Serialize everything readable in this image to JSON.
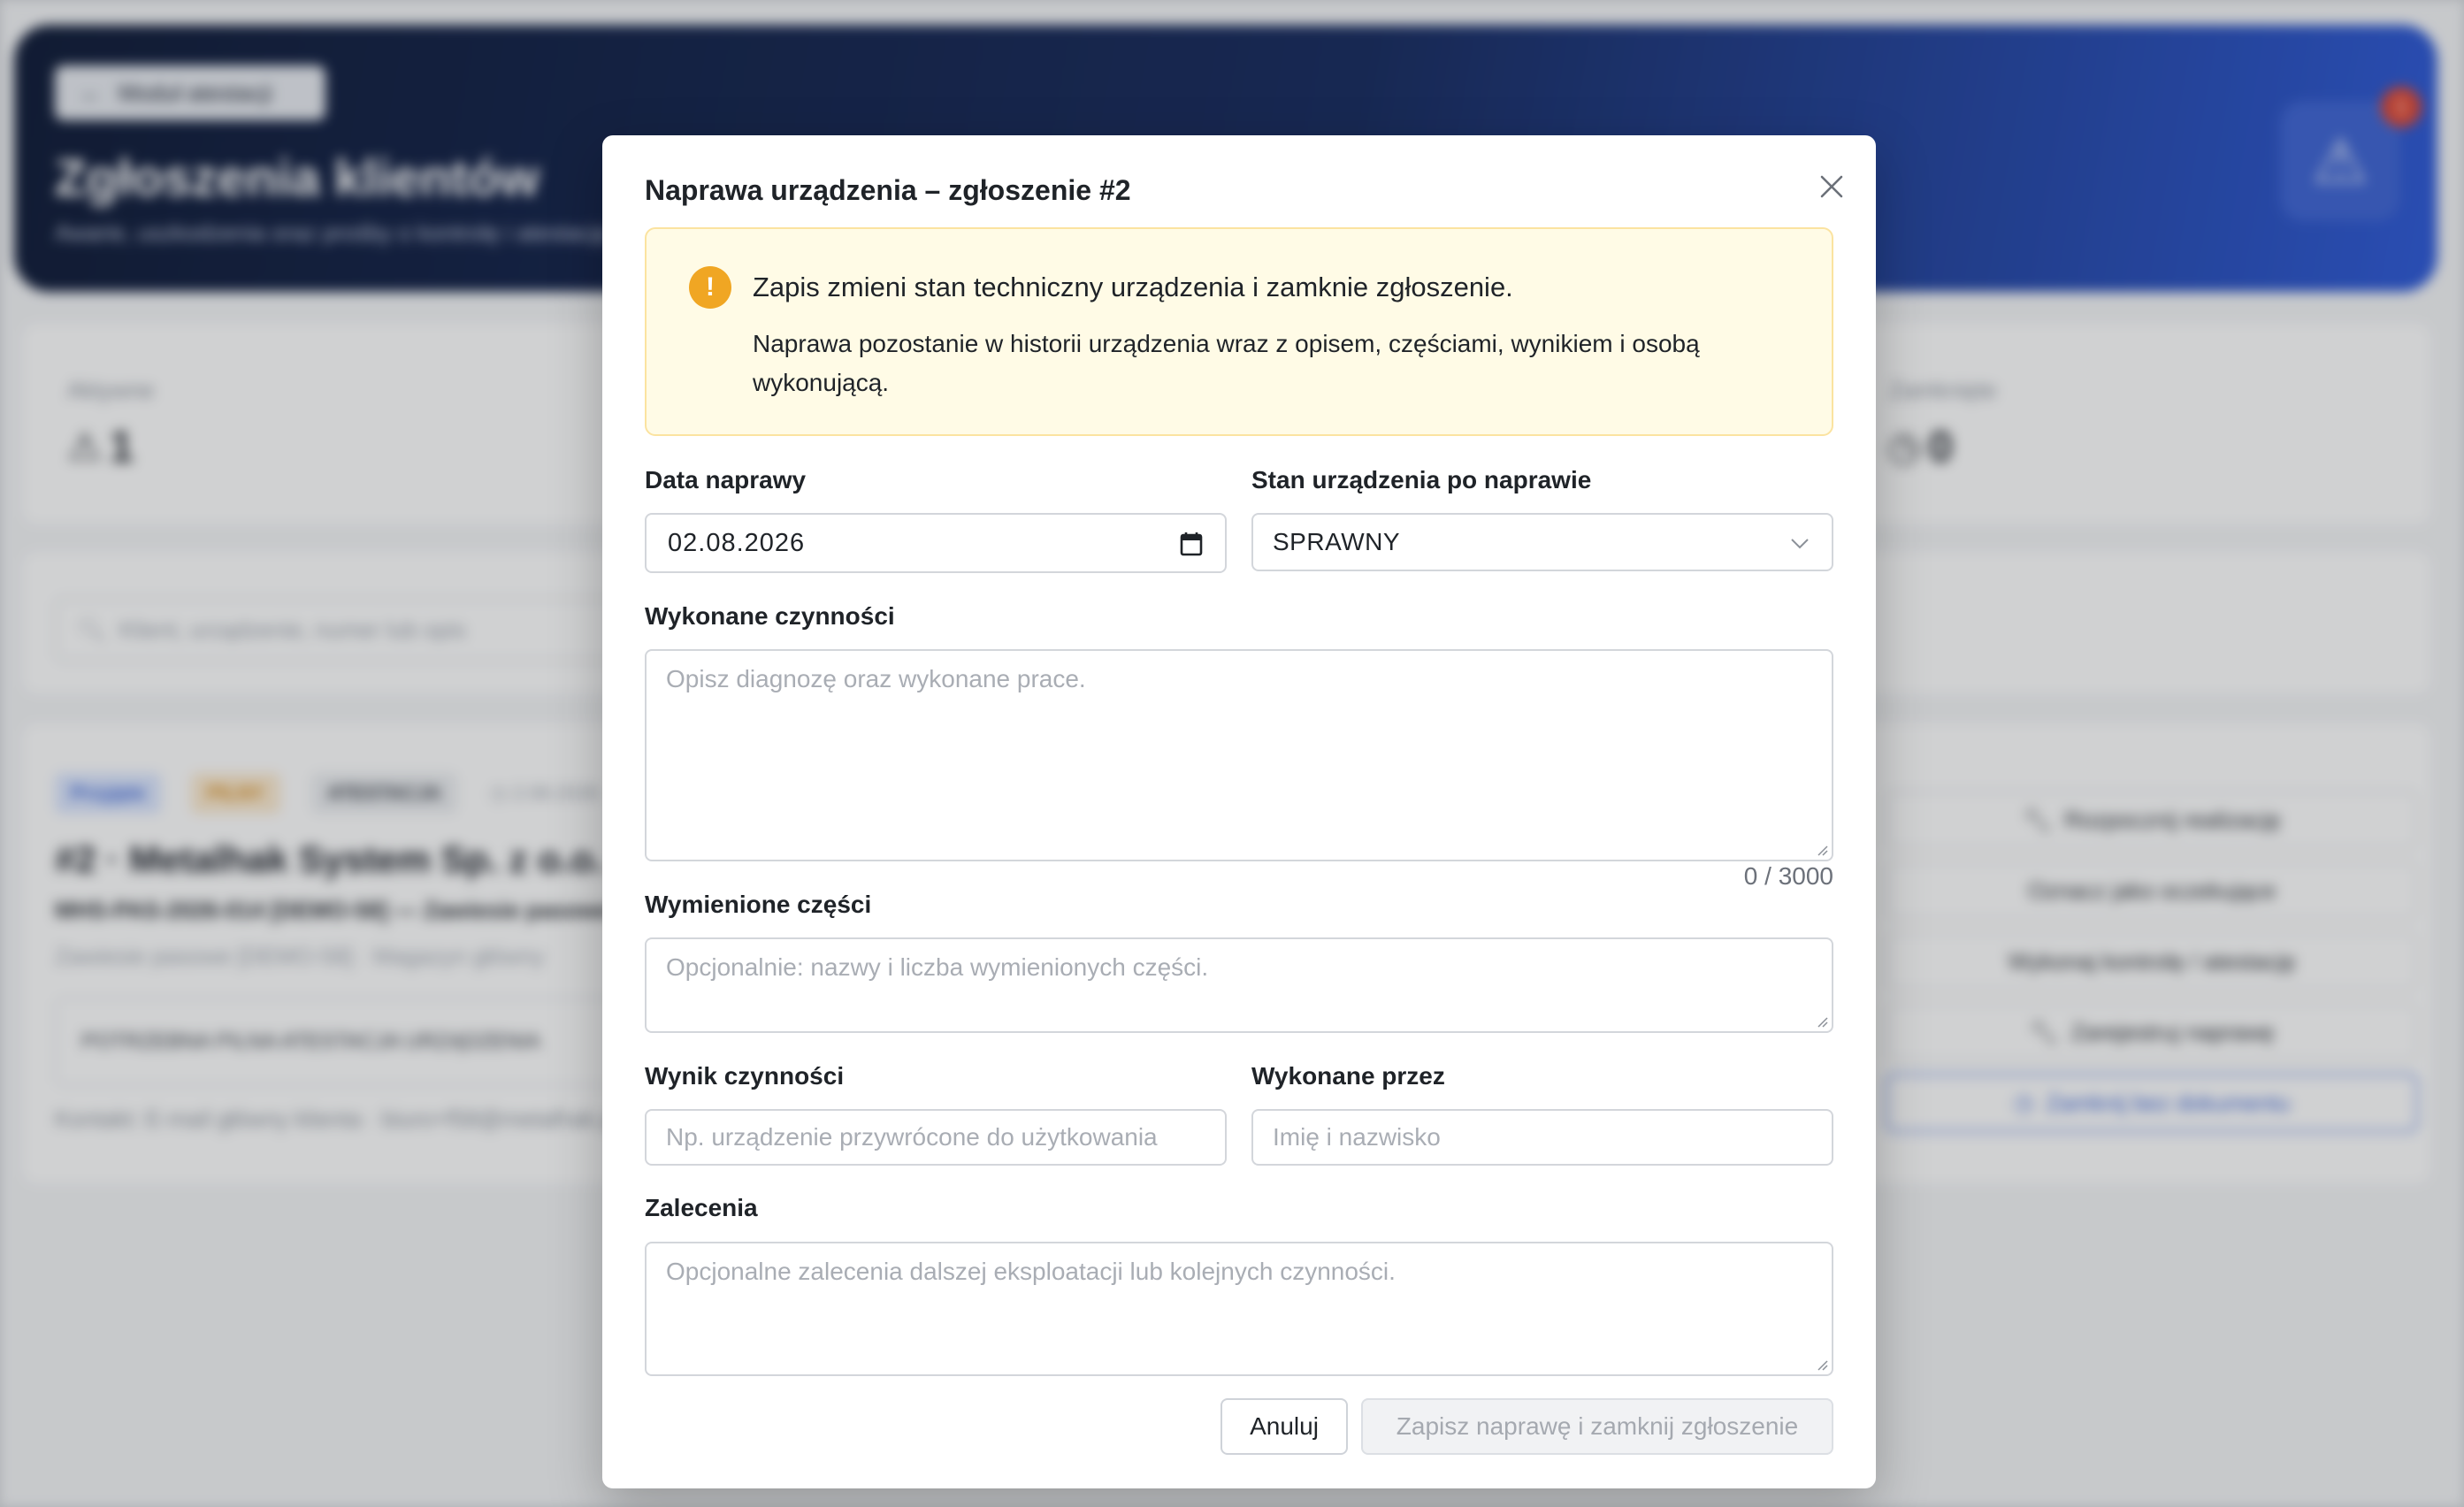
{
  "background": {
    "back_button_label": "Moduł atestacji",
    "page_title": "Zgłoszenia klientów",
    "page_subtitle": "Awarie, uszkodzenia oraz prośby o kontrolę i atestację",
    "alert_count": "1",
    "stats": {
      "active_label": "Aktywne",
      "active_value": "1",
      "closed_label": "Zamknięte",
      "closed_value": "0"
    },
    "search_placeholder": "Klient, urządzenie, numer lub opis",
    "ticket": {
      "tags": [
        "Przyjęte",
        "PILNY",
        "ATESTACJA",
        "2.08.2026"
      ],
      "title": "#2 · Metalhak System Sp. z o.o. [DEMO-58]",
      "subtitle": "MHS-PAS-2026-014 [DEMO-58] — Zawiesie pasowe",
      "meta": "Zawiesie pasowe [DEMO-58] · Magazyn główny",
      "description": "POTRZEBNA PILNA ATESTACJA URZĄDZENIA",
      "contact": "Kontakt: E-mail główny klienta · biuro+f58@metalhak.pl",
      "actions": [
        "Rozpocznij realizację",
        "Oznacz jako oczekujące",
        "Wykonaj kontrolę / atestację",
        "Zarejestruj naprawę",
        "Zamknij bez dokumentu"
      ]
    }
  },
  "modal": {
    "title": "Naprawa urządzenia – zgłoszenie #2",
    "warning": {
      "title": "Zapis zmieni stan techniczny urządzenia i zamknie zgłoszenie.",
      "text": "Naprawa pozostanie w historii urządzenia wraz z opisem, częściami, wynikiem i osobą wykonującą."
    },
    "repair_date": {
      "label": "Data naprawy",
      "value": "02.08.2026"
    },
    "device_state": {
      "label": "Stan urządzenia po naprawie",
      "value": "SPRAWNY"
    },
    "work_done": {
      "label": "Wykonane czynności",
      "placeholder": "Opisz diagnozę oraz wykonane prace.",
      "counter": "0 / 3000"
    },
    "parts": {
      "label": "Wymienione części",
      "placeholder": "Opcjonalnie: nazwy i liczba wymienionych części."
    },
    "result": {
      "label": "Wynik czynności",
      "placeholder": "Np. urządzenie przywrócone do użytkowania"
    },
    "performed_by": {
      "label": "Wykonane przez",
      "placeholder": "Imię i nazwisko"
    },
    "recommendations": {
      "label": "Zalecenia",
      "placeholder": "Opcjonalne zalecenia dalszej eksploatacji lub kolejnych czynności."
    },
    "cancel_label": "Anuluj",
    "save_label": "Zapisz naprawę i zamknij zgłoszenie"
  },
  "colors": {
    "warning_bg": "#fffbe6",
    "warning_icon": "#f0a623",
    "hero_gradient_start": "#0b1734",
    "hero_gradient_end": "#2a57d8"
  },
  "icons": [
    "arrow-left-icon",
    "warning-triangle-icon",
    "check-circle-icon",
    "search-icon",
    "clock-icon",
    "wrench-icon",
    "close-icon",
    "exclamation-icon",
    "calendar-icon",
    "chevron-down-icon"
  ]
}
